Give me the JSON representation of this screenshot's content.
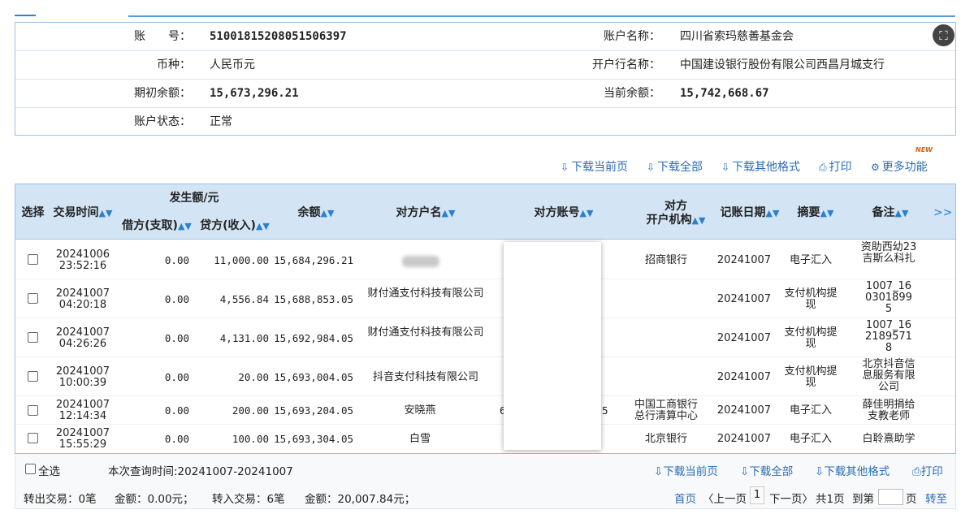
{
  "account": {
    "labels": {
      "number": "账　　号：",
      "name": "账户名称：",
      "currency": "币种：",
      "bank": "开户行名称：",
      "opening_balance": "期初余额：",
      "current_balance": "当前余额：",
      "status": "账户状态："
    },
    "number": "51001815208051506397",
    "name": "四川省索玛慈善基金会",
    "currency": "人民币元",
    "bank": "中国建设银行股份有限公司西昌月城支行",
    "opening_balance": "15,673,296.21",
    "current_balance": "15,742,668.67",
    "status": "正常"
  },
  "toolbar": {
    "download_page": "下载当前页",
    "download_all": "下载全部",
    "download_other": "下载其他格式",
    "print": "打印",
    "more": "更多功能",
    "new_badge": "NEW"
  },
  "table": {
    "headers": {
      "select": "选择",
      "time": "交易时间",
      "amount_group": "发生额/元",
      "debit": "借方(支取)",
      "credit": "贷方(收入)",
      "balance": "余额",
      "counterparty": "对方户名",
      "counter_account": "对方账号",
      "counter_bank_1": "对方",
      "counter_bank_2": "开户机构",
      "post_date": "记账日期",
      "summary": "摘要",
      "remark": "备注",
      "more": ">>"
    },
    "rows": [
      {
        "date": "20241006",
        "time": "23:52:16",
        "debit": "0.00",
        "credit": "11,000.00",
        "balance": "15,684,296.21",
        "name": "",
        "acct": "",
        "bank": "招商银行",
        "post": "20241007",
        "summary": "电子汇入",
        "remark": "资助西幼23吉斯么科扎"
      },
      {
        "date": "20241007",
        "time": "04:20:18",
        "debit": "0.00",
        "credit": "4,556.84",
        "balance": "15,688,853.05",
        "name": "财付通支付科技有限公司",
        "acct": "",
        "bank": "",
        "post": "20241007",
        "summary": "支付机构提现",
        "remark": "1007_1603018995"
      },
      {
        "date": "20241007",
        "time": "04:26:26",
        "debit": "0.00",
        "credit": "4,131.00",
        "balance": "15,692,984.05",
        "name": "财付通支付科技有限公司",
        "acct": "",
        "bank": "",
        "post": "20241007",
        "summary": "支付机构提现",
        "remark": "1007_1621895718"
      },
      {
        "date": "20241007",
        "time": "10:00:39",
        "debit": "0.00",
        "credit": "20.00",
        "balance": "15,693,004.05",
        "name": "抖音支付科技有限公司",
        "acct": "",
        "bank": "",
        "post": "20241007",
        "summary": "支付机构提现",
        "remark": "北京抖音信息服务有限公司"
      },
      {
        "date": "20241007",
        "time": "12:14:34",
        "debit": "0.00",
        "credit": "200.00",
        "balance": "15,693,204.05",
        "name": "安晓燕",
        "acct": "6",
        "acct_tail": "5",
        "bank": "中国工商银行总行清算中心",
        "post": "20241007",
        "summary": "电子汇入",
        "remark": "薛佳明捐给支教老师"
      },
      {
        "date": "20241007",
        "time": "15:55:29",
        "debit": "0.00",
        "credit": "100.00",
        "balance": "15,693,304.05",
        "name": "白雪",
        "acct": "",
        "bank": "北京银行",
        "post": "20241007",
        "summary": "电子汇入",
        "remark": "白聆熹助学"
      }
    ]
  },
  "footer": {
    "select_all": "全选",
    "query_time": "本次查询时间:20241007-20241007",
    "download_page": "下载当前页",
    "download_all": "下载全部",
    "download_other": "下载其他格式",
    "print": "打印",
    "stats_out": "转出交易：0笔",
    "stats_out_amt": "金额：0.00元；",
    "stats_in": "转入交易：6笔",
    "stats_in_amt": "金额：20,007.84元；",
    "first": "首页",
    "prev": "〈上一页",
    "page": "1",
    "next": "下一页〉",
    "total": "共1页",
    "goto": "到第",
    "page_unit": "页",
    "go": "转至"
  }
}
